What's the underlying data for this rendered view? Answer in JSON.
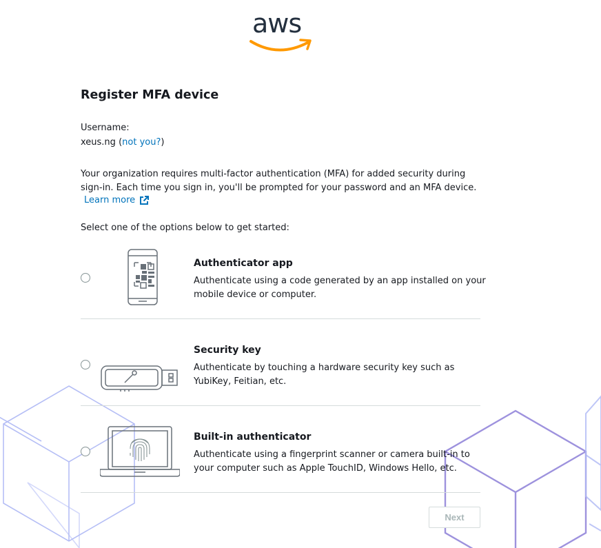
{
  "logo": {
    "text": "aws"
  },
  "page": {
    "title": "Register MFA device",
    "username_label": "Username:",
    "username_value": "xeus.ng",
    "not_you_link": "not you?",
    "description_lines": [
      "Your organization requires multi-factor authentication (MFA) for added security during",
      "sign-in. Each time you sign in, you'll be prompted for your password and an MFA device."
    ],
    "learn_more": "Learn more",
    "select_prompt": "Select one of the options below to get started:"
  },
  "options": [
    {
      "title": "Authenticator app",
      "icon": "phone-qr-icon",
      "desc_lines": [
        "Authenticate using a code generated by an app installed on your",
        "mobile device or computer."
      ]
    },
    {
      "title": "Security key",
      "icon": "usb-key-icon",
      "desc_lines": [
        "Authenticate by touching a hardware security key such as",
        "YubiKey, Feitian, etc."
      ]
    },
    {
      "title": "Built-in authenticator",
      "icon": "laptop-fingerprint-icon",
      "desc_lines": [
        "Authenticate using a fingerprint scanner or camera built-in to",
        "your computer such as Apple TouchID, Windows Hello, etc."
      ]
    }
  ],
  "footer": {
    "next_label": "Next"
  },
  "colors": {
    "link": "#0073bb",
    "aws_orange": "#ff9900",
    "text": "#16191f",
    "disabled": "#aab7b8",
    "cube_line": "#8d9bf2"
  }
}
